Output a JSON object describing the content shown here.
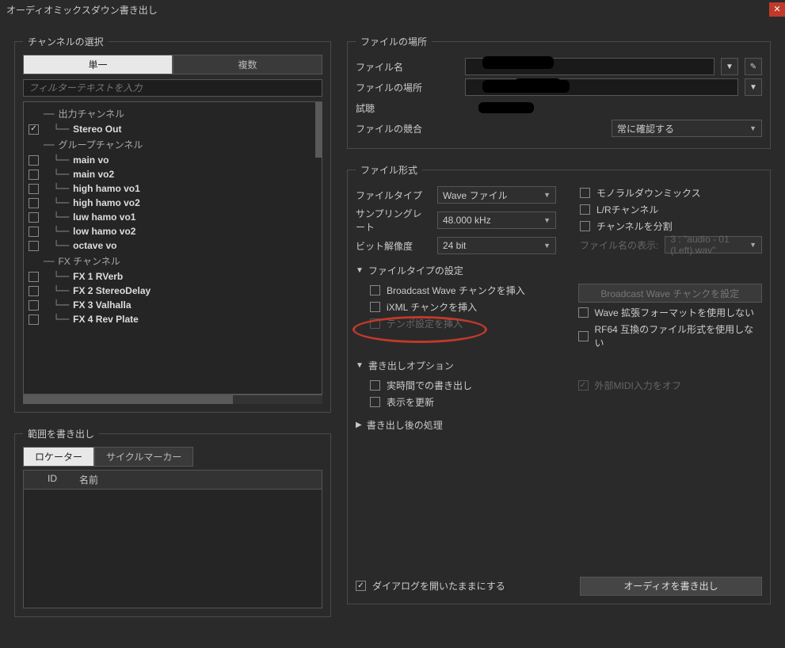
{
  "title": "オーディオミックスダウン書き出し",
  "channel_section": {
    "legend": "チャンネルの選択",
    "tab_single": "単一",
    "tab_multi": "複数",
    "filter_placeholder": "フィルターテキストを入力",
    "groups": [
      {
        "type": "header",
        "label": "出力チャンネル"
      },
      {
        "type": "item",
        "label": "Stereo Out",
        "checked": true,
        "bold": true
      },
      {
        "type": "header",
        "label": "グループチャンネル"
      },
      {
        "type": "item",
        "label": "main vo",
        "bold": true
      },
      {
        "type": "item",
        "label": "main vo2",
        "bold": true
      },
      {
        "type": "item",
        "label": "high hamo vo1",
        "bold": true
      },
      {
        "type": "item",
        "label": "high hamo vo2",
        "bold": true
      },
      {
        "type": "item",
        "label": "luw hamo vo1",
        "bold": true
      },
      {
        "type": "item",
        "label": "low hamo vo2",
        "bold": true
      },
      {
        "type": "item",
        "label": "octave vo",
        "bold": true
      },
      {
        "type": "header",
        "label": "FX チャンネル"
      },
      {
        "type": "item",
        "label": "FX 1 RVerb",
        "bold": true
      },
      {
        "type": "item",
        "label": "FX 2 StereoDelay",
        "bold": true
      },
      {
        "type": "item",
        "label": "FX 3 Valhalla",
        "bold": true
      },
      {
        "type": "item",
        "label": "FX 4 Rev Plate",
        "bold": true
      }
    ]
  },
  "range_section": {
    "legend": "範囲を書き出し",
    "tab_locator": "ロケーター",
    "tab_cycle": "サイクルマーカー",
    "col_id": "ID",
    "col_name": "名前"
  },
  "file_location": {
    "legend": "ファイルの場所",
    "name_label": "ファイル名",
    "path_label": "ファイルの場所",
    "preview_label": "試聴",
    "conflict_label": "ファイルの競合",
    "conflict_value": "常に確認する"
  },
  "file_format": {
    "legend": "ファイル形式",
    "filetype_label": "ファイルタイプ",
    "filetype_value": "Wave ファイル",
    "samplerate_label": "サンプリングレート",
    "samplerate_value": "48.000 kHz",
    "bitdepth_label": "ビット解像度",
    "bitdepth_value": "24 bit",
    "mono_label": "モノラルダウンミックス",
    "lr_label": "L/Rチャンネル",
    "split_label": "チャンネルを分割",
    "fname_display_label": "ファイル名の表示:",
    "fname_display_value": "3 : \"audio - 01 (Left).wav\"",
    "filetype_settings_header": "ファイルタイプの設定",
    "bwf_insert": "Broadcast Wave チャンクを挿入",
    "bwf_config_btn": "Broadcast Wave チャンクを設定",
    "ixml_insert": "iXML チャンクを挿入",
    "tempo_insert": "テンポ設定を挿入",
    "no_wave_ext": "Wave 拡張フォーマットを使用しない",
    "no_rf64": "RF64 互換のファイル形式を使用しない",
    "export_options_header": "書き出しオプション",
    "realtime": "実時間での書き出し",
    "update_display": "表示を更新",
    "ext_midi_off": "外部MIDI入力をオフ",
    "post_process_header": "書き出し後の処理"
  },
  "bottom": {
    "keep_dialog": "ダイアログを開いたままにする",
    "export_btn": "オーディオを書き出し"
  }
}
